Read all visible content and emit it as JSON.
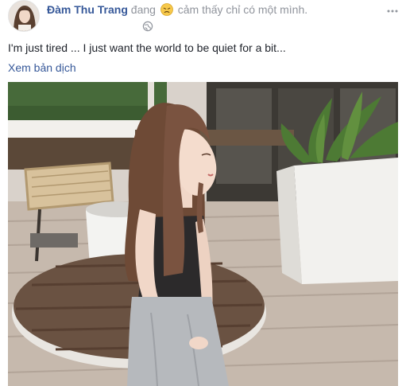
{
  "post": {
    "author_name": "Đàm Thu Trang",
    "status_prefix": "đang",
    "feeling_icon": "sad-face-icon",
    "feeling_text": "cảm thấy chỉ có một mình.",
    "audience_icon": "globe-icon",
    "options_icon": "more-options-icon",
    "message": "I'm just tired ... I just want the world to be quiet for a bit...",
    "translate_link": "Xem bản dịch"
  },
  "colors": {
    "author": "#365899",
    "meta_text": "#90949c",
    "body_text": "#1d2129",
    "emoji": "#f7c94b"
  }
}
